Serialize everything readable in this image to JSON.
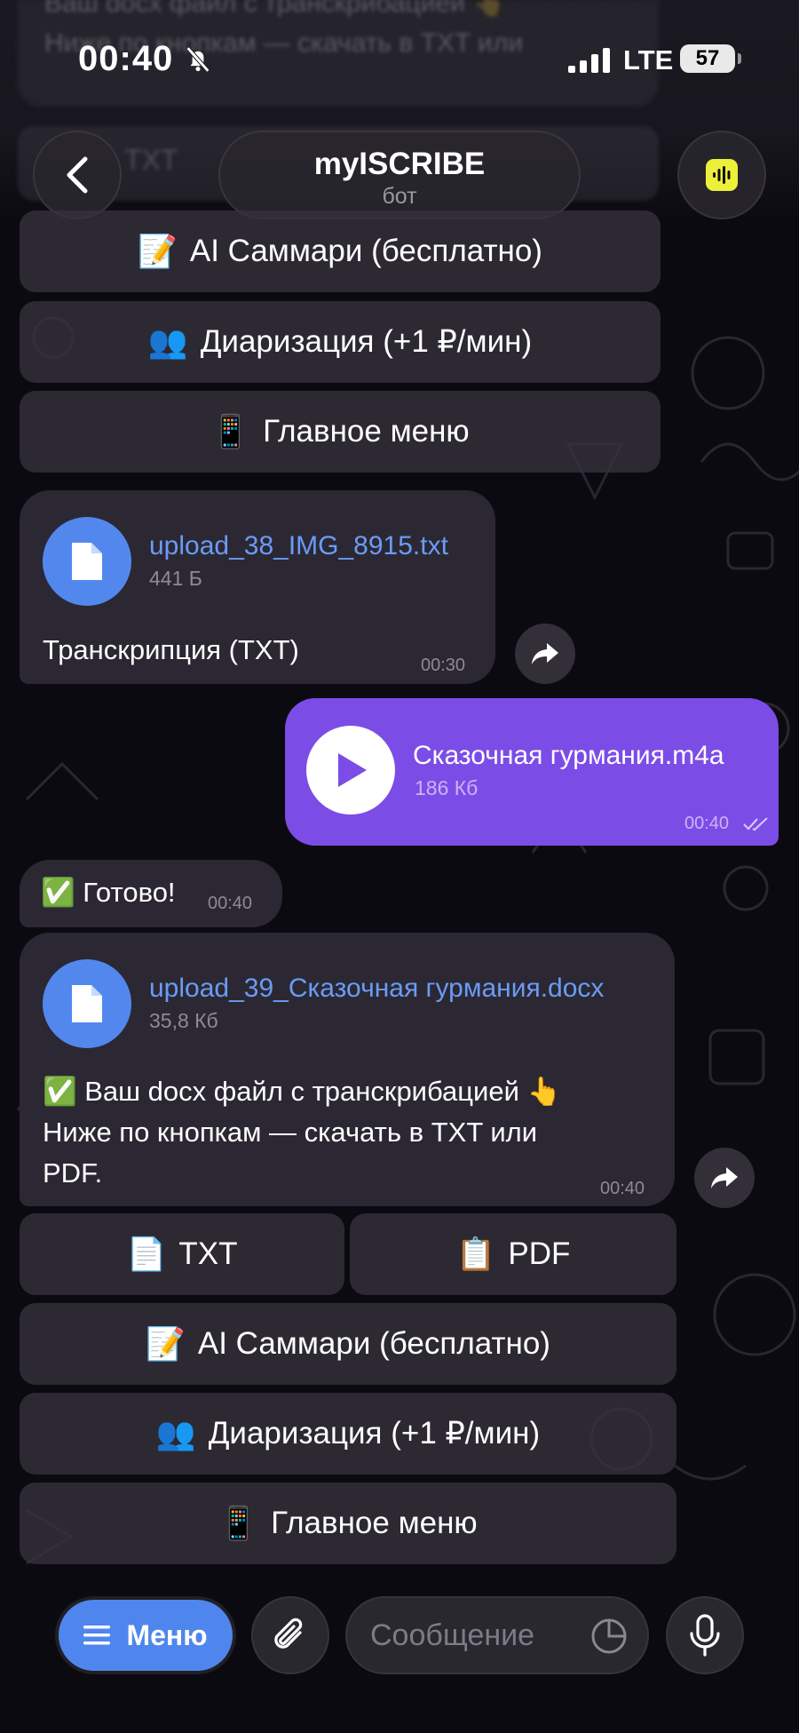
{
  "status": {
    "time": "00:40",
    "network": "LTE",
    "battery": "57"
  },
  "header": {
    "title": "myISCRIBE",
    "subtitle": "бот"
  },
  "top_keyboard": [
    {
      "emoji": "📝",
      "label": "AI Саммари (бесплатно)"
    },
    {
      "emoji": "👥",
      "label": "Диаризация (+1 ₽/мин)"
    },
    {
      "emoji": "📱",
      "label": "Главное меню"
    }
  ],
  "msg1": {
    "file_name": "upload_38_IMG_8915.txt",
    "file_size": "441 Б",
    "text": "Транскрипция (TXT)",
    "time": "00:30"
  },
  "msg2": {
    "file_name": "Сказочная гурмания.m4a",
    "file_size": "186 Кб",
    "time": "00:40"
  },
  "msg3": {
    "text": "✅ Готово!",
    "time": "00:40"
  },
  "msg4": {
    "file_name": "upload_39_Сказочная гурмания.docx",
    "file_size": "35,8 Кб",
    "line1": "✅ Ваш docx файл с транскрибацией 👆",
    "line2": "Ниже по кнопкам — скачать в TXT или",
    "line3": "PDF.",
    "time": "00:40"
  },
  "bottom_keyboard": {
    "txt": {
      "emoji": "📄",
      "label": "TXT"
    },
    "pdf": {
      "emoji": "📋",
      "label": "PDF"
    },
    "summary": {
      "emoji": "📝",
      "label": "AI Саммари (бесплатно)"
    },
    "diarization": {
      "emoji": "👥",
      "label": "Диаризация (+1 ₽/мин)"
    },
    "main_menu": {
      "emoji": "📱",
      "label": "Главное меню"
    }
  },
  "input_bar": {
    "menu_label": "Меню",
    "placeholder": "Сообщение"
  },
  "ghost": {
    "line1": "Ваш docx файл с транскрибацией 👆",
    "line2": "Ниже по кнопкам — скачать в TXT или",
    "btn": "TXT"
  },
  "colors": {
    "accent": "#4f86ee",
    "outgoing": "#7c4ce6",
    "bubble": "#2b2833",
    "link": "#6b9bf5"
  }
}
